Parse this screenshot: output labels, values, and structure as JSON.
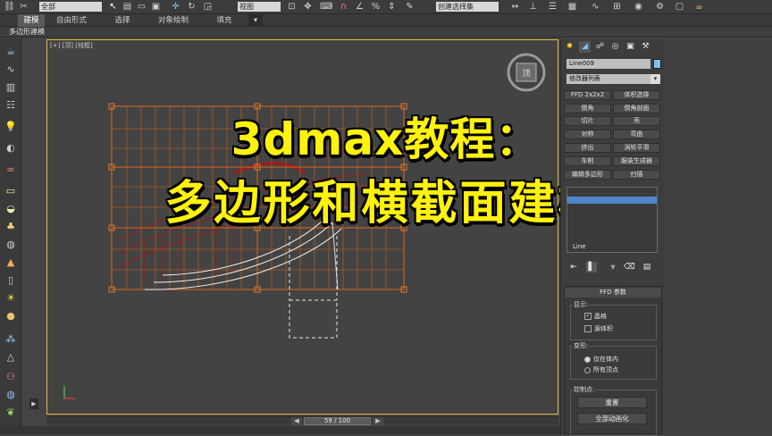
{
  "toolbar": {
    "selection_filter": "全部",
    "ref_coord": "视图",
    "named_selection": "创建选择集",
    "icons": [
      "link-icon",
      "unlink-icon",
      "select-icon",
      "select-region-icon",
      "move-icon",
      "rotate-icon",
      "scale-icon",
      "snap-icon",
      "mirror-icon",
      "align-icon",
      "render-icon"
    ]
  },
  "ribbon": {
    "tabs": [
      "建模",
      "自由形式",
      "选择",
      "对象绘制",
      "填充"
    ],
    "active_tab": "建模",
    "sub_label": "多边形建模"
  },
  "viewport": {
    "label": "[+] [顶] [线框]",
    "accent": "#e2b93a"
  },
  "overlay": {
    "line1": "3dmax教程：",
    "line2": "多边形和横截面建模",
    "color": "#fff20b"
  },
  "timeline": {
    "frame": "59 / 100"
  },
  "command_panel": {
    "object_name": "Line009",
    "modifier_list": "修改器列表",
    "modifier_buttons": [
      [
        "FFD 2x2x2",
        "体积选择"
      ],
      [
        "倒角",
        "倒角剖面"
      ],
      [
        "切片",
        "壳"
      ],
      [
        "对称",
        "弯曲"
      ],
      [
        "挤出",
        "涡轮平滑"
      ],
      [
        "车削",
        "服装生成器"
      ],
      [
        "编辑多边形",
        "扫描"
      ]
    ],
    "stack_bottom": "Line",
    "rollout_title": "FFD 参数",
    "display_group": "显示:",
    "display_opts": [
      {
        "label": "晶格",
        "checked": true
      },
      {
        "label": "源体积",
        "checked": false
      }
    ],
    "deform_group": "变形:",
    "deform_opts": [
      {
        "label": "仅在体内",
        "selected": true
      },
      {
        "label": "所有顶点",
        "selected": false
      }
    ],
    "control_group": "控制点:",
    "buttons": [
      "重置",
      "全部动画化"
    ]
  }
}
